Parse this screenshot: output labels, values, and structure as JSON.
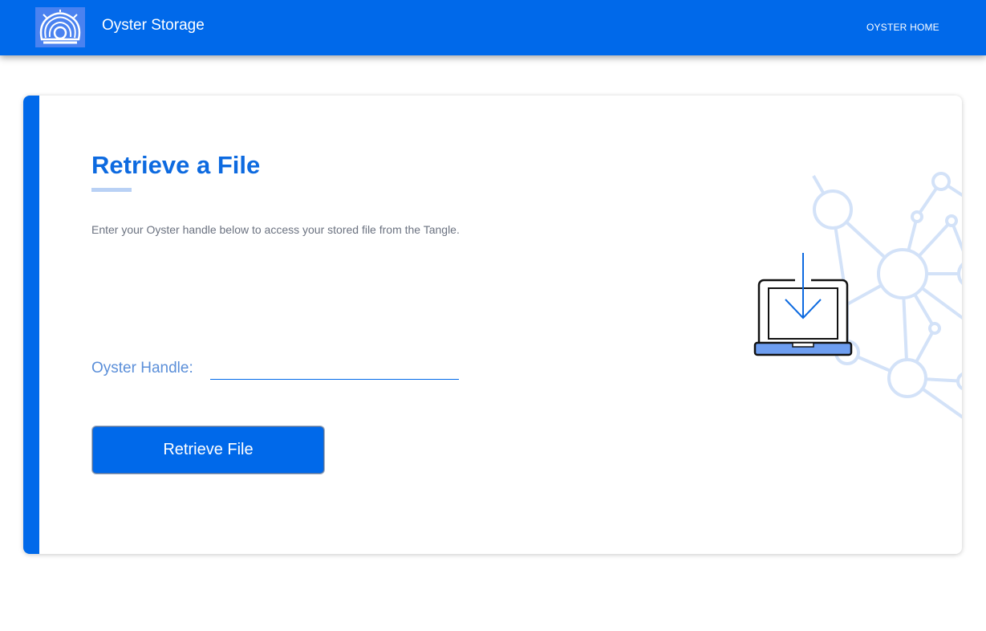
{
  "navbar": {
    "brand": "Oyster Storage",
    "home_link": "OYSTER HOME",
    "logo_icon": "oyster-shell-icon"
  },
  "main": {
    "title": "Retrieve a File",
    "description": "Enter your Oyster handle below to access your stored file from the Tangle.",
    "handle_label": "Oyster Handle:",
    "handle_value": "",
    "handle_placeholder": "",
    "submit_label": "Retrieve File",
    "illustration_icon": "laptop-download-icon",
    "background_graphic": "network-nodes-graphic"
  },
  "colors": {
    "primary": "#0069ea",
    "title": "#0d6ae0",
    "underline": "#b9d1f5",
    "label": "#5b8fd9",
    "muted_text": "#6b7280",
    "network": "#d3e2f8"
  }
}
